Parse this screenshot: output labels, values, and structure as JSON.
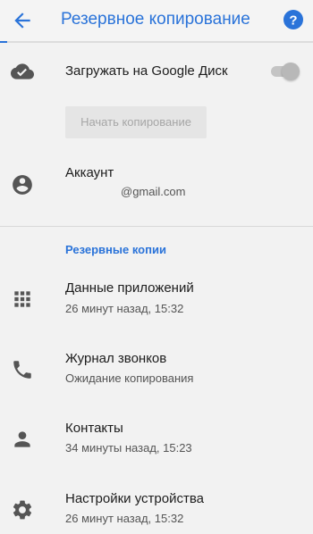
{
  "header": {
    "title": "Резервное копирование"
  },
  "settings": {
    "upload_label": "Загружать на Google Диск",
    "upload_enabled": true,
    "upload_interactive": false,
    "start_backup_label": "Начать копирование",
    "account_label": "Аккаунт",
    "account_email": "@gmail.com"
  },
  "backups": {
    "section_title": "Резервные копии",
    "items": [
      {
        "icon": "apps-grid-icon",
        "title": "Данные приложений",
        "subtitle": "26 минут назад, 15:32"
      },
      {
        "icon": "phone-icon",
        "title": "Журнал звонков",
        "subtitle": "Ожидание копирования"
      },
      {
        "icon": "person-icon",
        "title": "Контакты",
        "subtitle": "34 минуты назад, 15:23"
      },
      {
        "icon": "gear-icon",
        "title": "Настройки устройства",
        "subtitle": "26 минут назад, 15:32"
      }
    ]
  },
  "colors": {
    "accent": "#2a73d9",
    "background": "#f2f2f2",
    "icon": "#555555",
    "primary_text": "#1c1c1c",
    "secondary_text": "#555555",
    "disabled": "#a6a6a6"
  }
}
